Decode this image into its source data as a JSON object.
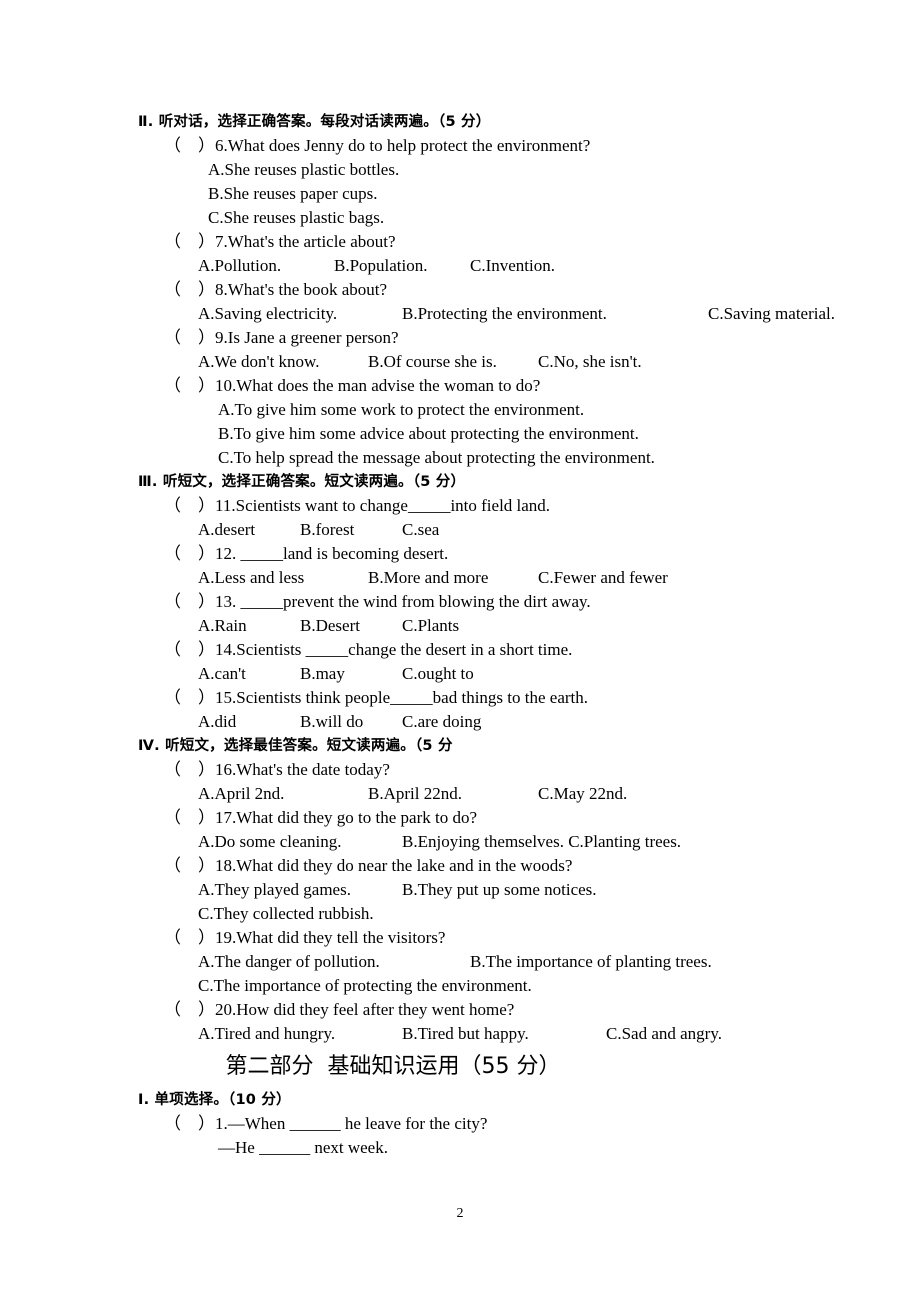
{
  "page": {
    "number": "2"
  },
  "sections": [
    {
      "id": "section-2",
      "heading": "Ⅱ. 听对话，选择正确答案。每段对话读两遍。（5 分）",
      "questions": [
        {
          "prompt": "（    ）6.What does Jenny do to help protect the environment?",
          "options_lines": [
            "A.She reuses plastic bottles.",
            "B.She reuses paper cups.",
            "C.She reuses plastic bags."
          ],
          "indent": "ind-a"
        },
        {
          "prompt": "（    ）7.What's the article about?",
          "options_lines": [
            "A.Pollution.\t\tB.Population.\t\tC.Invention."
          ],
          "indent": "ind-a3"
        },
        {
          "prompt": "（    ）8.What's the book about?",
          "options_lines": [
            "A.Saving electricity.\t\tB.Protecting the environment.\t\t\tC.Saving material."
          ],
          "indent": "ind-a3"
        },
        {
          "prompt": "（    ）9.Is Jane a greener person?",
          "options_lines": [
            "A.We don't know.\t\tB.Of course she is.\t\tC.No, she isn't."
          ],
          "indent": "ind-a3"
        },
        {
          "prompt": "（    ）10.What does the man advise the woman to do?",
          "options_lines": [
            "A.To give him some work to protect the environment.",
            "B.To give him some advice about protecting the environment.",
            "C.To help spread the message about protecting the environment."
          ],
          "indent": "ind-a2"
        }
      ]
    },
    {
      "id": "section-3",
      "heading": "Ⅲ. 听短文，选择正确答案。短文读两遍。（5 分）",
      "questions": [
        {
          "prompt": "（    ）11.Scientists want to change_____into field land.",
          "options_lines": [
            "A.desert\t\tB.forest\t\tC.sea"
          ],
          "indent": "ind-a3"
        },
        {
          "prompt": "（    ）12. _____land is becoming desert.",
          "options_lines": [
            "A.Less and less\t\tB.More and more\t\tC.Fewer and fewer"
          ],
          "indent": "ind-a3"
        },
        {
          "prompt": "（    ）13. _____prevent the wind from blowing the dirt away.",
          "options_lines": [
            "A.Rain\t\tB.Desert\t\tC.Plants"
          ],
          "indent": "ind-a3"
        },
        {
          "prompt": "（    ）14.Scientists _____change the desert in a short time.",
          "options_lines": [
            "A.can't\t\tB.may\t\tC.ought to"
          ],
          "indent": "ind-a3"
        },
        {
          "prompt": "（    ）15.Scientists think people_____bad things to the earth.",
          "options_lines": [
            "A.did\t\tB.will do\t\tC.are doing"
          ],
          "indent": "ind-a3"
        }
      ]
    },
    {
      "id": "section-4",
      "heading": "Ⅳ. 听短文，选择最佳答案。短文读两遍。（5 分",
      "questions": [
        {
          "prompt": "（    ）16.What's the date today?",
          "options_lines": [
            "A.April 2nd.\t\t\tB.April 22nd.\t\t\tC.May 22nd."
          ],
          "indent": "ind-a3"
        },
        {
          "prompt": "（    ）17.What did they go to the park to do?",
          "options_lines": [
            "A.Do some cleaning.\t\tB.Enjoying themselves. C.Planting trees."
          ],
          "indent": "ind-a3"
        },
        {
          "prompt": "（    ）18.What did they do near the lake and in the woods?",
          "options_lines": [
            "A.They played games.\t\tB.They put up some notices.",
            "C.They collected rubbish."
          ],
          "indent": "ind-a3"
        },
        {
          "prompt": "（    ）19.What did they tell the visitors?",
          "options_lines": [
            "A.The danger of pollution.\t\t\tB.The importance of planting trees.",
            "C.The importance of protecting the environment."
          ],
          "indent": "ind-a3"
        },
        {
          "prompt": "（    ）20.How did they feel after they went home?",
          "options_lines": [
            "A.Tired and hungry.\t\tB.Tired but happy.\t\t\tC.Sad and angry."
          ],
          "indent": "ind-a3"
        }
      ]
    }
  ],
  "part_heading": "第二部分  基础知识运用（55 分）",
  "final_section": {
    "id": "section-1-choice",
    "heading": "Ⅰ. 单项选择。（10 分）",
    "questions": [
      {
        "prompt": "（    ）1.—When ______ he leave for the city?",
        "options_lines": [
          "—He ______ next week."
        ],
        "indent": "ind-dash"
      }
    ]
  }
}
